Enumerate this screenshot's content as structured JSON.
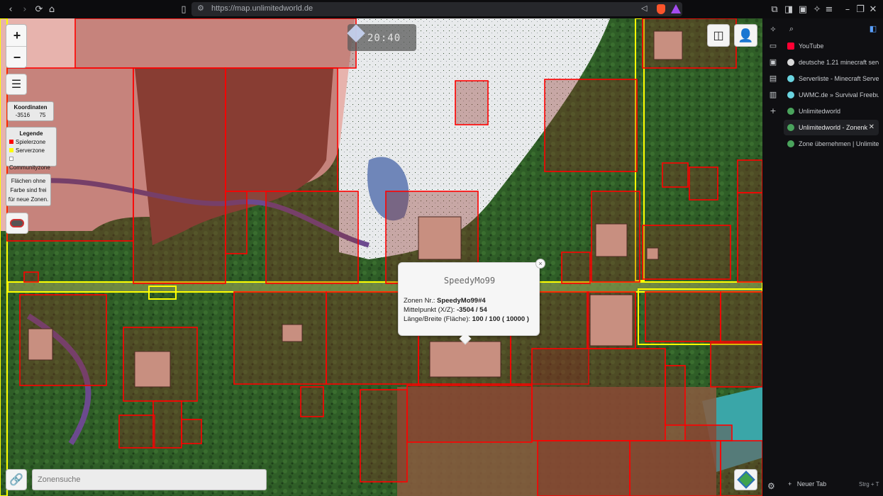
{
  "browser": {
    "url": "https://map.unlimitedworld.de",
    "new_tab_label": "Neuer Tab",
    "new_tab_shortcut": "Strg + T"
  },
  "tabs": [
    {
      "label": "YouTube",
      "favicon_color": "#ff0033"
    },
    {
      "label": "deutsche 1.21 minecraft serv",
      "favicon_color": "#d9d9d9"
    },
    {
      "label": "Serverliste - Minecraft Serve",
      "favicon_color": "#6ad4e0"
    },
    {
      "label": "UWMC.de » Survival Freebu",
      "favicon_color": "#6ad4e0"
    },
    {
      "label": "Unlimitedworld",
      "favicon_color": "#4aa35c"
    },
    {
      "label": "Unlimitedworld - Zonenk",
      "favicon_color": "#4aa35c",
      "active": true
    },
    {
      "label": "Zone übernehmen | Unlimite",
      "favicon_color": "#4aa35c"
    }
  ],
  "map": {
    "zoom_in": "+",
    "zoom_out": "−",
    "coords_title": "Koordinaten",
    "coords_x": "-3516",
    "coords_z": "75",
    "legend_title": "Legende",
    "legend": [
      {
        "label": "Spielerzone",
        "color": "#ff0000"
      },
      {
        "label": "Serverzone",
        "color": "#ffff00"
      },
      {
        "label": "Communityzone",
        "color": "#ffffff"
      }
    ],
    "free_note": [
      "Flächen ohne",
      "Farbe sind frei",
      "für neue Zonen."
    ],
    "time": "20:40",
    "search_placeholder": "Zonensuche",
    "popup": {
      "title": "SpeedyMo99",
      "zone_label": "Zonen Nr.:",
      "zone_value": "SpeedyMo99#4",
      "center_label": "Mittelpunkt (X/Z):",
      "center_value": "-3504 / 54",
      "size_label": "Länge/Breite (Fläche):",
      "size_value": "100 / 100 ( 10000 )",
      "close": "×"
    },
    "zone_color_player": "#ff0000",
    "zone_color_server": "#ffff00"
  }
}
